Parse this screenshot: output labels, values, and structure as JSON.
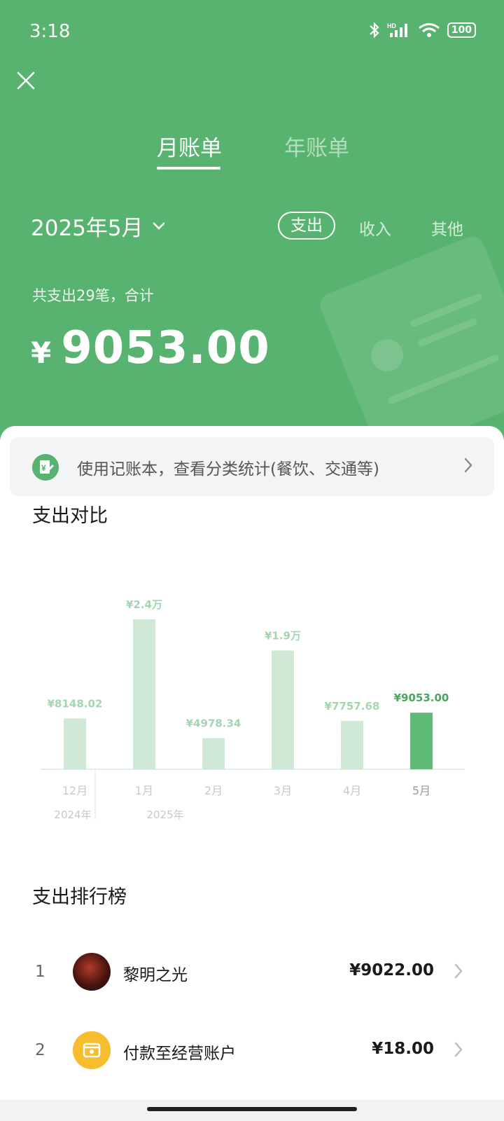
{
  "status_bar": {
    "time": "3:18",
    "battery": "100"
  },
  "tabs": [
    {
      "label": "月账单"
    },
    {
      "label": "年账单"
    }
  ],
  "month_selector": {
    "label": "2025年5月"
  },
  "filters": [
    {
      "label": "支出"
    },
    {
      "label": "收入"
    },
    {
      "label": "其他"
    }
  ],
  "summary": {
    "text": "共支出29笔，合计",
    "currency": "¥",
    "amount": "9053.00"
  },
  "notice": {
    "text": "使用记账本，查看分类统计(餐饮、交通等)"
  },
  "comparison": {
    "title": "支出对比"
  },
  "chart_data": {
    "type": "bar",
    "categories": [
      "12月",
      "1月",
      "2月",
      "3月",
      "4月",
      "5月"
    ],
    "values": [
      8148.02,
      24000,
      4978.34,
      19000,
      7757.68,
      9053.0
    ],
    "data_labels": [
      "¥8148.02",
      "¥2.4万",
      "¥4978.34",
      "¥1.9万",
      "¥7757.68",
      "¥9053.00"
    ],
    "year_labels": [
      {
        "label": "2024年"
      },
      {
        "label": "2025年"
      }
    ],
    "highlight_index": 5,
    "colors": {
      "bar": "#cfe9d6",
      "highlight": "#5fba75",
      "label": "#a5d4b2",
      "highlight_label": "#4aa560",
      "axis_label": "#c8c8c8"
    },
    "title": "支出对比",
    "xlabel": "",
    "ylabel": "",
    "ylim": [
      0,
      26000
    ],
    "grid": false
  },
  "ranking": {
    "title": "支出排行榜",
    "items": [
      {
        "rank": "1",
        "name": "黎明之光",
        "amount": "¥9022.00",
        "icon": "dragon-avatar"
      },
      {
        "rank": "2",
        "name": "付款至经营账户",
        "amount": "¥18.00",
        "icon": "shop-icon"
      }
    ]
  },
  "colors": {
    "brand": "#57b36f"
  }
}
